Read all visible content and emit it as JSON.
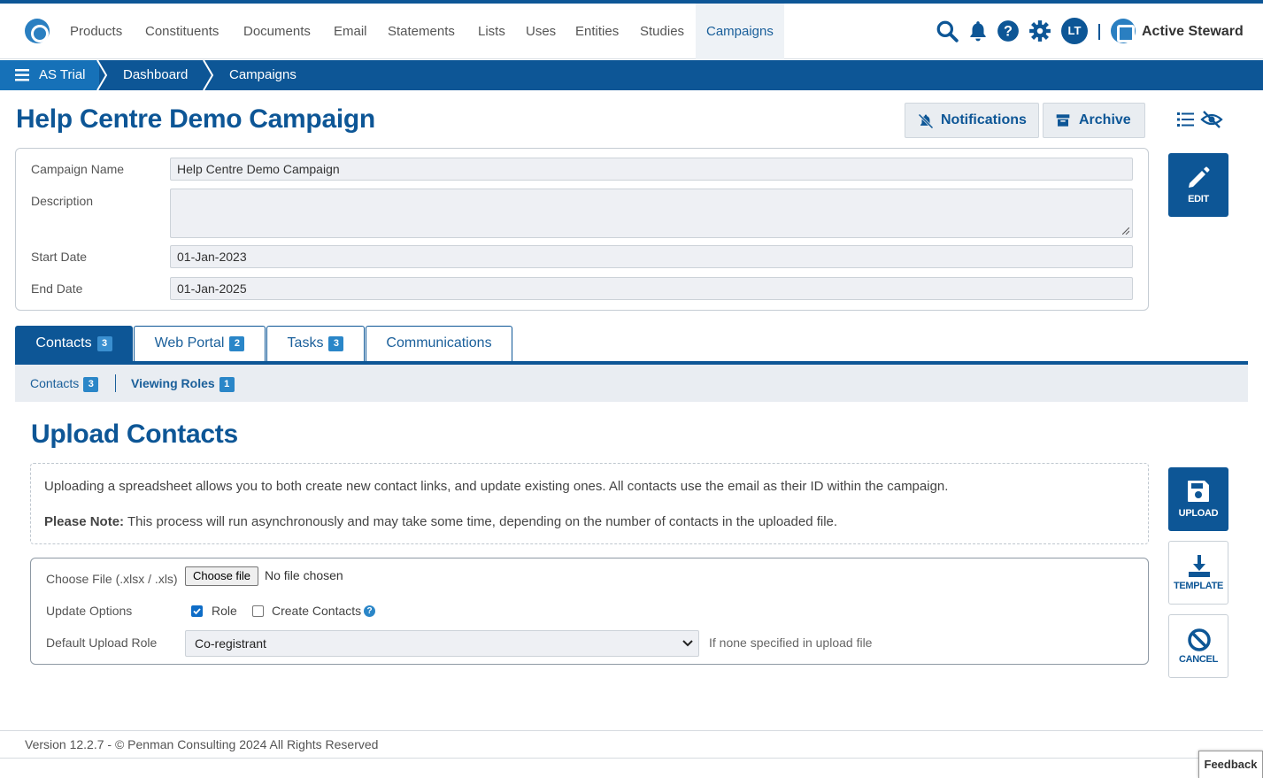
{
  "nav": {
    "items": [
      "Products",
      "Constituents",
      "Documents",
      "Email",
      "Statements",
      "Lists",
      "Uses",
      "Entities",
      "Studies",
      "Campaigns"
    ],
    "active": "Campaigns",
    "avatar_initials": "LT",
    "brand": "Active Steward"
  },
  "breadcrumb": {
    "items": [
      "AS Trial",
      "Dashboard",
      "Campaigns"
    ]
  },
  "page": {
    "title": "Help Centre Demo Campaign",
    "notifications_label": "Notifications",
    "archive_label": "Archive",
    "edit_label": "EDIT"
  },
  "campaign": {
    "name_label": "Campaign Name",
    "name_value": "Help Centre Demo Campaign",
    "description_label": "Description",
    "description_value": "",
    "start_label": "Start Date",
    "start_value": "01-Jan-2023",
    "end_label": "End Date",
    "end_value": "01-Jan-2025"
  },
  "tabs": [
    {
      "label": "Contacts",
      "count": "3"
    },
    {
      "label": "Web Portal",
      "count": "2"
    },
    {
      "label": "Tasks",
      "count": "3"
    },
    {
      "label": "Communications",
      "count": ""
    }
  ],
  "subtabs": [
    {
      "label": "Contacts",
      "count": "3"
    },
    {
      "label": "Viewing Roles",
      "count": "1"
    }
  ],
  "upload": {
    "heading": "Upload Contacts",
    "info_line1": "Uploading a spreadsheet allows you to both create new contact links, and update existing ones. All contacts use the email as their ID within the campaign.",
    "note_bold": "Please Note:",
    "note_text": " This process will run asynchronously and may take some time, depending on the number of contacts in the uploaded file.",
    "file_label": "Choose File (.xlsx / .xls)",
    "file_button": "Choose file",
    "file_status": "No file chosen",
    "options_label": "Update Options",
    "option_role": "Role",
    "option_role_checked": true,
    "option_create": "Create Contacts",
    "option_create_checked": false,
    "help_glyph": "?",
    "role_label": "Default Upload Role",
    "role_value": "Co-registrant",
    "role_hint": "If none specified in upload file",
    "upload_btn": "UPLOAD",
    "template_btn": "TEMPLATE",
    "cancel_btn": "CANCEL"
  },
  "footer": {
    "text": "Version 12.2.7 - © Penman Consulting 2024 All Rights Reserved",
    "feedback": "Feedback"
  },
  "colors": {
    "brand_blue": "#0d5696",
    "badge_blue": "#2a86c8"
  }
}
